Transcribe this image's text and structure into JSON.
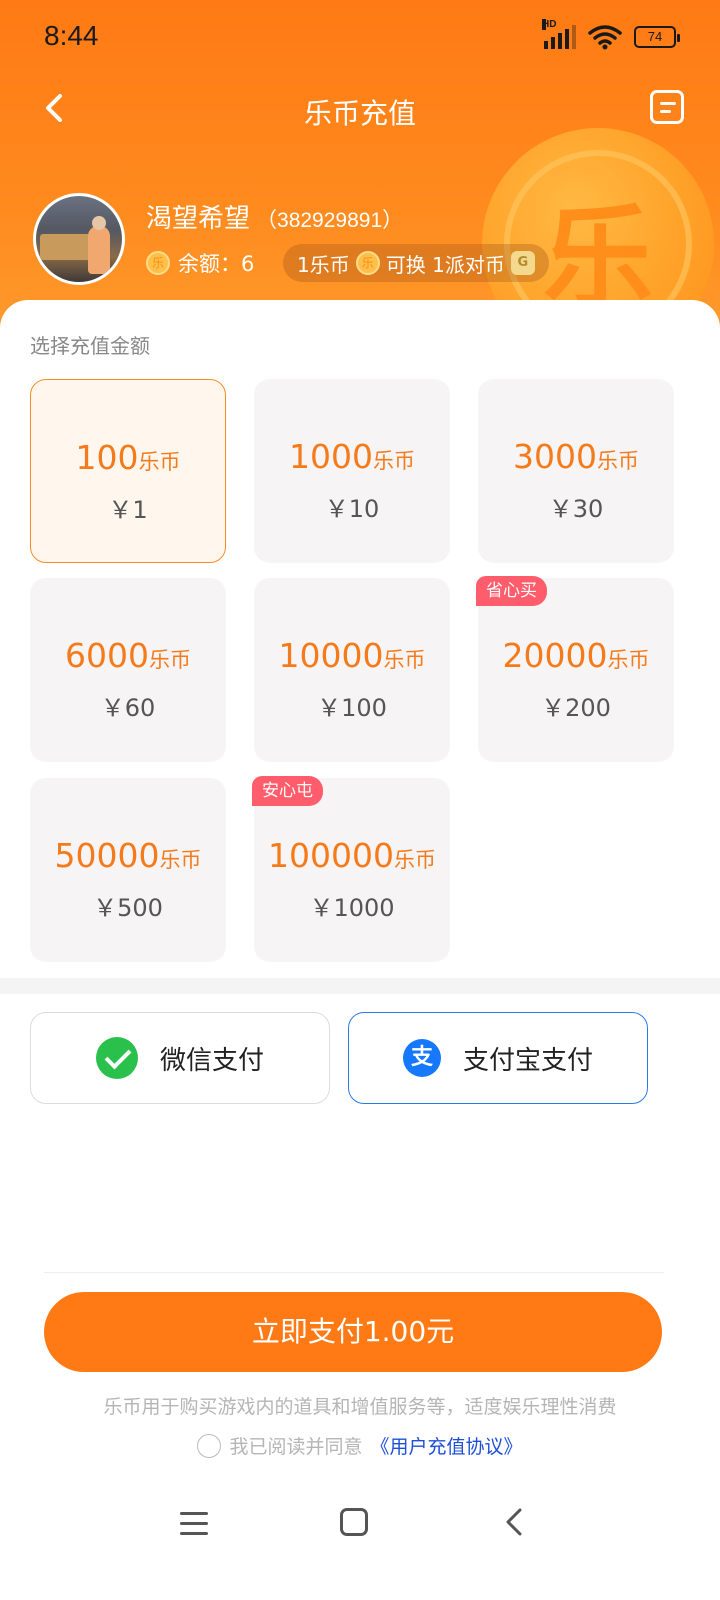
{
  "status": {
    "time": "8:44",
    "network": "HD",
    "battery": "74"
  },
  "nav": {
    "title": "乐币充值",
    "back_icon": "chevron-left-icon",
    "history_icon": "order-list-icon"
  },
  "user": {
    "name": "渴望希望",
    "uid": "（382929891）",
    "balance_label": "余额：",
    "balance": "6"
  },
  "exchange": {
    "part1": "1乐币",
    "part2": "可换 1派对币"
  },
  "coin_glyph": "乐",
  "party_glyph": "G",
  "section": {
    "label": "选择充值金额"
  },
  "packages": [
    {
      "amount": "100",
      "unit": "乐币",
      "price": "￥1",
      "badge": "",
      "selected": true
    },
    {
      "amount": "1000",
      "unit": "乐币",
      "price": "￥10",
      "badge": ""
    },
    {
      "amount": "3000",
      "unit": "乐币",
      "price": "￥30",
      "badge": ""
    },
    {
      "amount": "6000",
      "unit": "乐币",
      "price": "￥60",
      "badge": ""
    },
    {
      "amount": "10000",
      "unit": "乐币",
      "price": "￥100",
      "badge": ""
    },
    {
      "amount": "20000",
      "unit": "乐币",
      "price": "￥200",
      "badge": "省心买"
    },
    {
      "amount": "50000",
      "unit": "乐币",
      "price": "￥500",
      "badge": ""
    },
    {
      "amount": "100000",
      "unit": "乐币",
      "price": "￥1000",
      "badge": "安心屯"
    }
  ],
  "payment": {
    "wechat": "微信支付",
    "alipay": "支付宝支付",
    "alipay_glyph": "支",
    "selected": "alipay"
  },
  "pay_button": "立即支付1.00元",
  "notice": "乐币用于购买游戏内的道具和增值服务等，适度娱乐理性消费",
  "agreement": {
    "prefix": "我已阅读并同意",
    "link": "《用户充值协议》"
  },
  "colors": {
    "accent": "#ff7a14",
    "price_orange": "#f57a1a",
    "badge_red": "#ff5d6b",
    "link_blue": "#1d4fd8",
    "select_blue": "#2c7be5"
  }
}
